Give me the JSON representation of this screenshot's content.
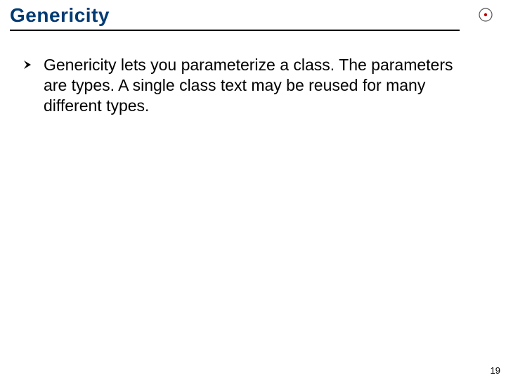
{
  "header": {
    "title": "Genericity"
  },
  "body": {
    "bullets": [
      {
        "text": "Genericity lets you parameterize a class. The parameters are types. A single class text may be reused for many different types."
      }
    ]
  },
  "footer": {
    "page_number": "19"
  },
  "icons": {
    "bullet_glyph": "arrow-right-chevron",
    "logo": "circle-dot"
  }
}
